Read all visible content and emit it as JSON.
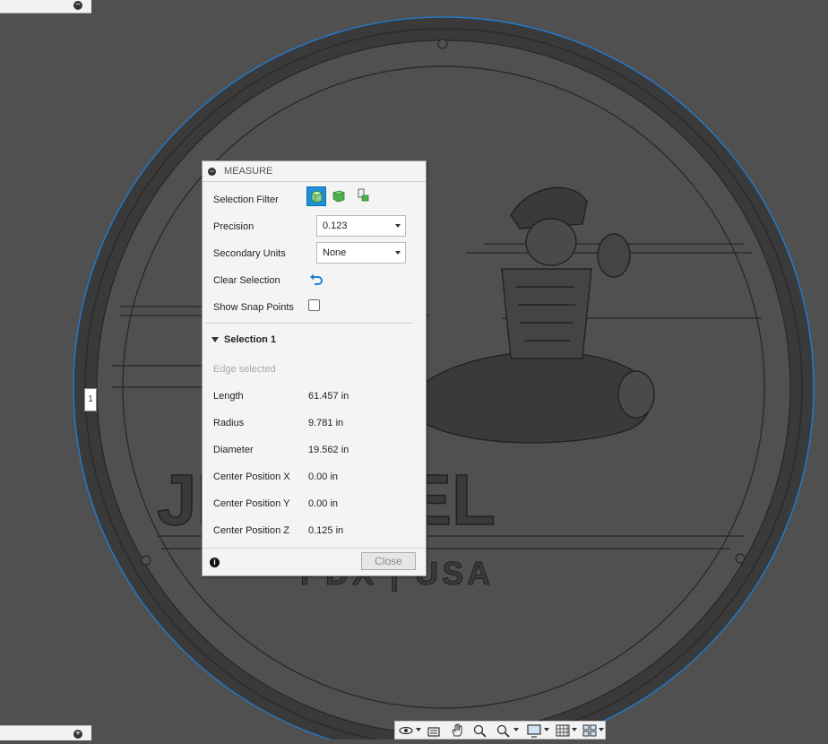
{
  "dialog": {
    "title": "MEASURE",
    "selection_filter_label": "Selection Filter",
    "precision_label": "Precision",
    "precision_value": "0.123",
    "secondary_units_label": "Secondary Units",
    "secondary_units_value": "None",
    "clear_selection_label": "Clear Selection",
    "show_snap_points_label": "Show Snap Points",
    "show_snap_points_checked": false,
    "section_title": "Selection 1",
    "selection_status": "Edge selected",
    "measurements": [
      {
        "label": "Length",
        "value": "61.457 in"
      },
      {
        "label": "Radius",
        "value": "9.781 in"
      },
      {
        "label": "Diameter",
        "value": "19.562 in"
      },
      {
        "label": "Center Position X",
        "value": "0.00 in"
      },
      {
        "label": "Center Position Y",
        "value": "0.00 in"
      },
      {
        "label": "Center Position Z",
        "value": "0.125 in"
      }
    ],
    "close_label": "Close"
  },
  "viewport": {
    "edge_marker_label": "1",
    "model_text_main": "JET FUEL",
    "model_text_sub": "PDX | USA",
    "colors": {
      "background": "#505050",
      "part": "#3a3a3a",
      "selection": "#1e7fd8"
    }
  },
  "toolbar": {
    "icons": [
      "orbit-icon",
      "look-at-icon",
      "pan-icon",
      "zoom-icon",
      "fit-icon",
      "display-settings-icon",
      "grid-icon",
      "viewports-icon"
    ]
  }
}
